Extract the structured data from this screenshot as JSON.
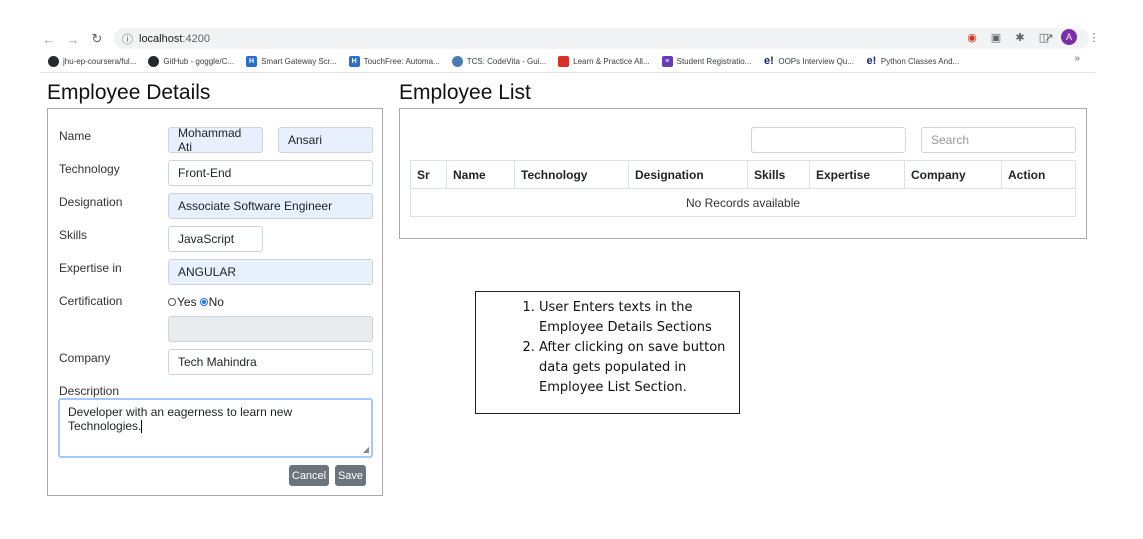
{
  "browser": {
    "url_host": "localhost",
    "url_port": ":4200",
    "profile_initial": "A",
    "bookmarks": [
      {
        "label": "jhu-ep-coursera/ful...",
        "icon": "github-icon",
        "color": "#24292e"
      },
      {
        "label": "GitHub - goggle/C...",
        "icon": "github-icon",
        "color": "#24292e"
      },
      {
        "label": "Smart Gateway Scr...",
        "icon": "hackerearth-icon",
        "color": "#2c6ecb"
      },
      {
        "label": "TouchFree: Automa...",
        "icon": "hackerearth-icon",
        "color": "#2c6ecb"
      },
      {
        "label": "TCS: CodeVita - Gui...",
        "icon": "tcs-icon",
        "color": "#4a7bb7"
      },
      {
        "label": "Learn & Practice All...",
        "icon": "practice-icon",
        "color": "#d93025"
      },
      {
        "label": "Student Registratio...",
        "icon": "forms-icon",
        "color": "#673ab7"
      },
      {
        "label": "OOPs Interview Qu...",
        "icon": "e-icon",
        "color": "#1a237e"
      },
      {
        "label": "Python Classes And...",
        "icon": "e-icon",
        "color": "#1a237e"
      }
    ],
    "more_label": "»"
  },
  "details": {
    "title": "Employee Details",
    "labels": {
      "name": "Name",
      "technology": "Technology",
      "designation": "Designation",
      "skills": "Skills",
      "expertise": "Expertise in",
      "certification": "Certification",
      "company": "Company",
      "description": "Description"
    },
    "values": {
      "first_name": "Mohammad Ati",
      "last_name": "Ansari",
      "technology": "Front-End",
      "designation": "Associate Software Engineer",
      "skills": "JavaScript",
      "expertise": "ANGULAR",
      "certification_detail": "",
      "company": "Tech Mahindra",
      "description": "Developer with an eagerness to learn new Technologies."
    },
    "radio": {
      "yes_label": "Yes",
      "no_label": "No",
      "selected": "No"
    },
    "buttons": {
      "cancel": "Cancel",
      "save": "Save"
    }
  },
  "list": {
    "title": "Employee List",
    "filter_value": "",
    "search_placeholder": "Search",
    "columns": [
      "Sr",
      "Name",
      "Technology",
      "Designation",
      "Skills",
      "Expertise",
      "Company",
      "Action"
    ],
    "empty_message": "No Records available"
  },
  "note": {
    "items": [
      "User Enters texts in the Employee Details Sections",
      "After clicking on save button data gets populated in Employee List Section."
    ]
  }
}
